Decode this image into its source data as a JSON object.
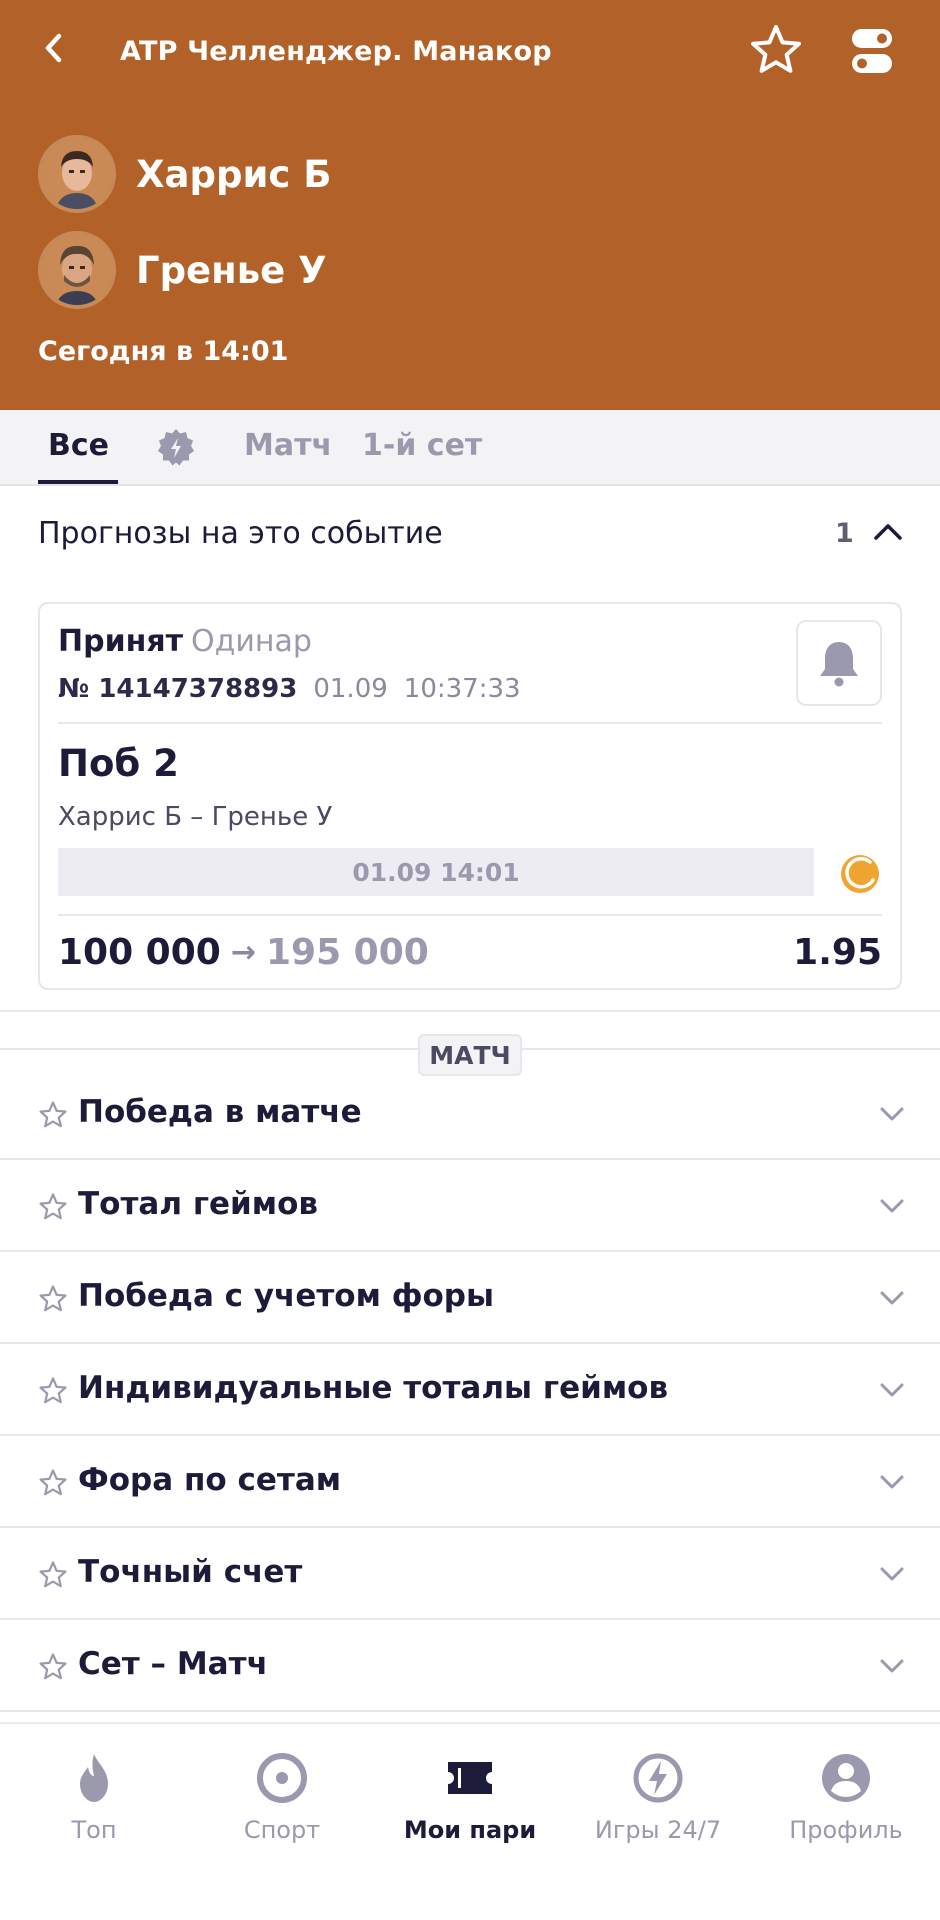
{
  "header": {
    "title": "ATP Челленджер. Манакор",
    "player1": "Харрис Б",
    "player2": "Гренье У",
    "start_time": "Сегодня в 14:01",
    "bg_color": "#b26228"
  },
  "tabs": [
    {
      "label": "Все",
      "active": true
    },
    {
      "label": "",
      "icon": "badge-icon"
    },
    {
      "label": "Матч"
    },
    {
      "label": "1-й сет"
    }
  ],
  "predictions": {
    "title": "Прогнозы на это событие",
    "count": "1"
  },
  "bet": {
    "status": "Принят",
    "type": "Одинар",
    "number_label": "№ 14147378893",
    "date": "01.09",
    "time": "10:37:33",
    "outcome": "Поб 2",
    "match": "Харрис Б – Гренье У",
    "event_datetime": "01.09 14:01",
    "stake": "100 000",
    "payout": "195 000",
    "odds": "1.95"
  },
  "section_label": "МАТЧ",
  "markets": [
    "Победа в матче",
    "Тотал геймов",
    "Победа с учетом форы",
    "Индивидуальные тоталы геймов",
    "Фора по сетам",
    "Точный счет",
    "Сет – Матч"
  ],
  "bottom_nav": [
    {
      "label": "Топ",
      "icon": "flame-icon"
    },
    {
      "label": "Спорт",
      "icon": "sport-icon"
    },
    {
      "label": "Мои пари",
      "icon": "ticket-icon",
      "active": true
    },
    {
      "label": "Игры 24/7",
      "icon": "lightning-icon"
    },
    {
      "label": "Профиль",
      "icon": "profile-icon"
    }
  ],
  "colors": {
    "accent": "#b26228",
    "text_dark": "#1c1b3a",
    "text_muted": "#9a99ad",
    "tennis_ball": "#f0a431"
  }
}
